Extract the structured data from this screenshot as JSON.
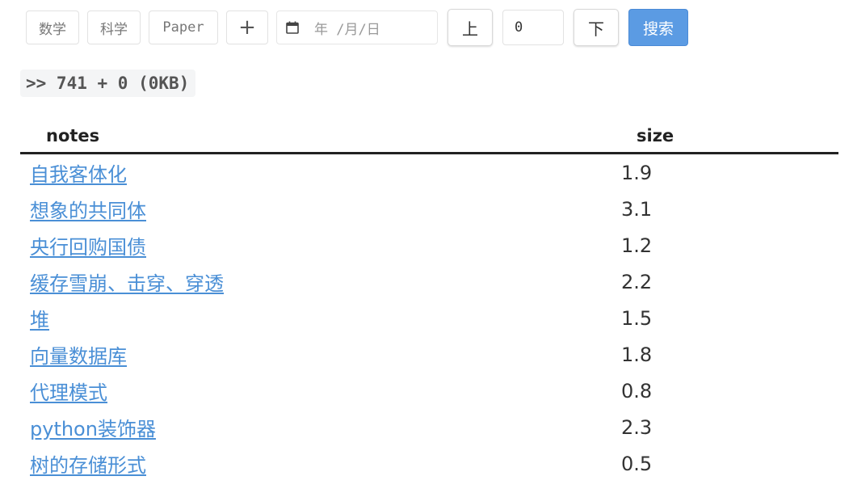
{
  "toolbar": {
    "categories": [
      "数学",
      "科学",
      "Paper"
    ],
    "add_label": "+",
    "date_placeholder": "年 /月/日",
    "prev_label": "上",
    "page_number": "0",
    "next_label": "下",
    "search_label": "搜索"
  },
  "stats": {
    "text": ">> 741 + 0 (0KB)"
  },
  "table": {
    "headers": [
      "notes",
      "size"
    ],
    "rows": [
      {
        "name": "自我客体化",
        "size": "1.9"
      },
      {
        "name": "想象的共同体",
        "size": "3.1"
      },
      {
        "name": "央行回购国债",
        "size": "1.2"
      },
      {
        "name": "缓存雪崩、击穿、穿透",
        "size": "2.2"
      },
      {
        "name": "堆",
        "size": "1.5"
      },
      {
        "name": "向量数据库",
        "size": "1.8"
      },
      {
        "name": "代理模式",
        "size": "0.8"
      },
      {
        "name": "python装饰器",
        "size": "2.3"
      },
      {
        "name": "树的存储形式",
        "size": "0.5"
      }
    ]
  },
  "colors": {
    "link": "#4a8fd6",
    "primary_button": "#5b9be3"
  }
}
